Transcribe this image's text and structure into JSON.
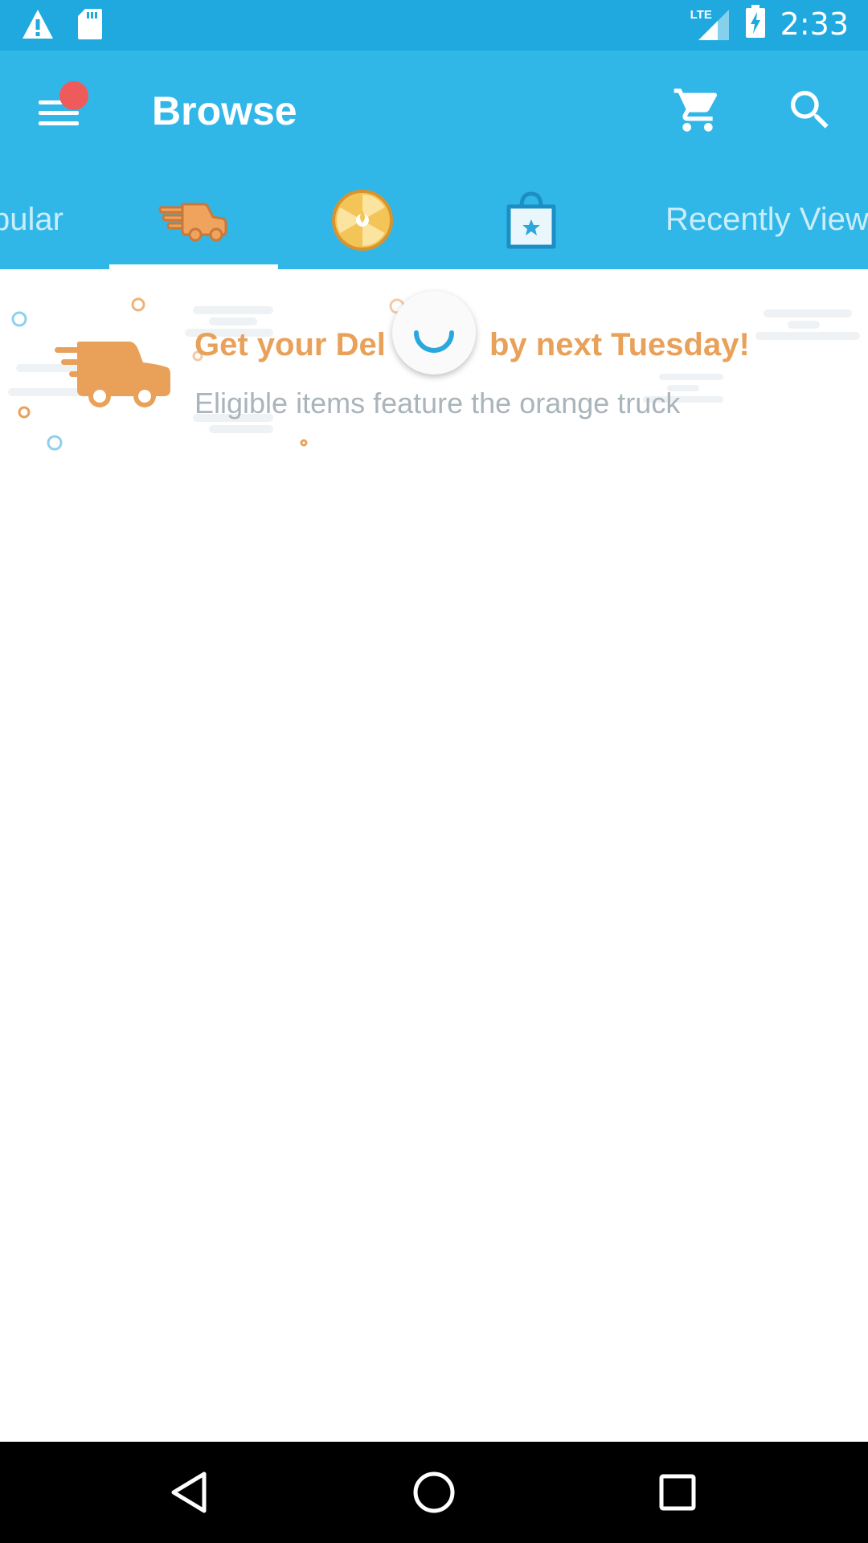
{
  "status_bar": {
    "time": "2:33",
    "network_label": "LTE",
    "icons": [
      "warning-icon",
      "sd-card-icon",
      "signal-icon",
      "battery-charging-icon"
    ]
  },
  "app_bar": {
    "title": "Browse",
    "icons": [
      "menu-icon",
      "cart-icon",
      "search-icon"
    ],
    "notification_color": "#ef5b5b"
  },
  "tabs": [
    {
      "type": "text",
      "label": "Popular",
      "visible_text": "pular"
    },
    {
      "type": "icon",
      "icon": "delivery-truck-icon",
      "selected": true
    },
    {
      "type": "icon",
      "icon": "wheel-icon"
    },
    {
      "type": "icon",
      "icon": "shopping-bag-star-icon"
    },
    {
      "type": "text",
      "label": "Recently Viewed",
      "visible_text": "Recently View"
    }
  ],
  "banner": {
    "title_left": "Get your Del",
    "title_right": "by next Tuesday!",
    "subtitle": "Eligible items feature the orange truck",
    "accent_color": "#e9a15a"
  },
  "loading_indicator": {
    "icon": "spinner-icon",
    "color": "#2aa8dd"
  },
  "nav_bar": {
    "icons": [
      "back-icon",
      "home-icon",
      "recents-icon"
    ]
  },
  "colors": {
    "status_bar": "#1fa9df",
    "app_bar": "#30b7e8"
  }
}
